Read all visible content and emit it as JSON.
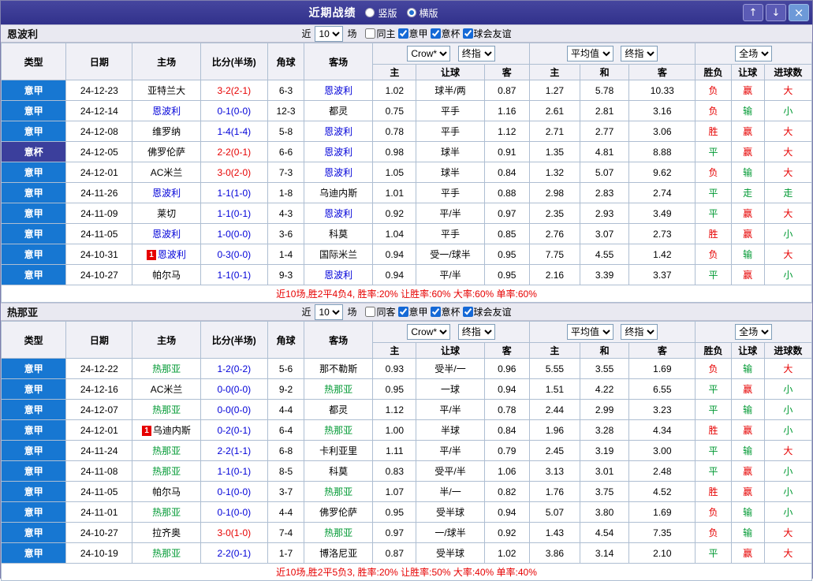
{
  "titlebar": {
    "title": "近期战绩",
    "radios": [
      "竖版",
      "横版"
    ],
    "selected_index": 1,
    "up_icon": "↑",
    "down_icon": "↓",
    "close_icon": "×"
  },
  "colors": {
    "r": "#e60000",
    "g": "#009933",
    "b": "#0000d8",
    "k": "#000000",
    "accent_blue": "#1569d6"
  },
  "league_colors": {
    "意甲": "#1777d2",
    "意杯": "#3b3f9c"
  },
  "filter": {
    "prefix": "近",
    "rounds": "10",
    "suffix": "场",
    "same_side_checked": false,
    "serie_a_label": "意甲",
    "serie_a_checked": true,
    "coppa_label": "意杯",
    "coppa_checked": true,
    "friendly_label": "球会友谊",
    "friendly_checked": true
  },
  "columns": {
    "type": "类型",
    "date": "日期",
    "home": "主场",
    "score": "比分(半场)",
    "corners": "角球",
    "away": "客场",
    "odds_home": "主",
    "odds_handicap": "让球",
    "odds_away": "客",
    "avg_home": "主",
    "avg_draw": "和",
    "avg_away": "客",
    "result": "胜负",
    "handicap_result": "让球",
    "goals": "进球数"
  },
  "selects": {
    "company": "Crow*",
    "company_stage": "终指",
    "average": "平均值",
    "average_stage": "终指",
    "scope": "全场"
  },
  "sections": [
    {
      "team": "恩波利",
      "same_side_label": "同主",
      "footer": "近10场,胜2平4负4, 胜率:20% 让胜率:60% 大率:60% 单率:60%",
      "rows": [
        {
          "league": "意甲",
          "date": "24-12-23",
          "home": "亚特兰大",
          "home_color": "k",
          "home_badge": "",
          "score": "3-2(2-1)",
          "score_color": "r",
          "corners": "6-3",
          "away": "恩波利",
          "away_color": "b",
          "away_badge": "",
          "odds": [
            "1.02",
            "球半/两",
            "0.87"
          ],
          "avg": [
            "1.27",
            "5.78",
            "10.33"
          ],
          "result": "负",
          "result_color": "r",
          "handicap_result": "赢",
          "handicap_color": "r",
          "goals": "大",
          "goals_color": "r"
        },
        {
          "league": "意甲",
          "date": "24-12-14",
          "home": "恩波利",
          "home_color": "b",
          "home_badge": "",
          "score": "0-1(0-0)",
          "score_color": "b",
          "corners": "12-3",
          "away": "都灵",
          "away_color": "k",
          "away_badge": "",
          "odds": [
            "0.75",
            "平手",
            "1.16"
          ],
          "avg": [
            "2.61",
            "2.81",
            "3.16"
          ],
          "result": "负",
          "result_color": "r",
          "handicap_result": "输",
          "handicap_color": "g",
          "goals": "小",
          "goals_color": "g"
        },
        {
          "league": "意甲",
          "date": "24-12-08",
          "home": "维罗纳",
          "home_color": "k",
          "home_badge": "",
          "score": "1-4(1-4)",
          "score_color": "b",
          "corners": "5-8",
          "away": "恩波利",
          "away_color": "b",
          "away_badge": "",
          "odds": [
            "0.78",
            "平手",
            "1.12"
          ],
          "avg": [
            "2.71",
            "2.77",
            "3.06"
          ],
          "result": "胜",
          "result_color": "r",
          "handicap_result": "赢",
          "handicap_color": "r",
          "goals": "大",
          "goals_color": "r"
        },
        {
          "league": "意杯",
          "date": "24-12-05",
          "home": "佛罗伦萨",
          "home_color": "k",
          "home_badge": "",
          "score": "2-2(0-1)",
          "score_color": "r",
          "corners": "6-6",
          "away": "恩波利",
          "away_color": "b",
          "away_badge": "",
          "odds": [
            "0.98",
            "球半",
            "0.91"
          ],
          "avg": [
            "1.35",
            "4.81",
            "8.88"
          ],
          "result": "平",
          "result_color": "g",
          "handicap_result": "赢",
          "handicap_color": "r",
          "goals": "大",
          "goals_color": "r"
        },
        {
          "league": "意甲",
          "date": "24-12-01",
          "home": "AC米兰",
          "home_color": "k",
          "home_badge": "",
          "score": "3-0(2-0)",
          "score_color": "r",
          "corners": "7-3",
          "away": "恩波利",
          "away_color": "b",
          "away_badge": "",
          "odds": [
            "1.05",
            "球半",
            "0.84"
          ],
          "avg": [
            "1.32",
            "5.07",
            "9.62"
          ],
          "result": "负",
          "result_color": "r",
          "handicap_result": "输",
          "handicap_color": "g",
          "goals": "大",
          "goals_color": "r"
        },
        {
          "league": "意甲",
          "date": "24-11-26",
          "home": "恩波利",
          "home_color": "b",
          "home_badge": "",
          "score": "1-1(1-0)",
          "score_color": "b",
          "corners": "1-8",
          "away": "乌迪内斯",
          "away_color": "k",
          "away_badge": "",
          "odds": [
            "1.01",
            "平手",
            "0.88"
          ],
          "avg": [
            "2.98",
            "2.83",
            "2.74"
          ],
          "result": "平",
          "result_color": "g",
          "handicap_result": "走",
          "handicap_color": "g",
          "goals": "走",
          "goals_color": "g"
        },
        {
          "league": "意甲",
          "date": "24-11-09",
          "home": "莱切",
          "home_color": "k",
          "home_badge": "",
          "score": "1-1(0-1)",
          "score_color": "b",
          "corners": "4-3",
          "away": "恩波利",
          "away_color": "b",
          "away_badge": "",
          "odds": [
            "0.92",
            "平/半",
            "0.97"
          ],
          "avg": [
            "2.35",
            "2.93",
            "3.49"
          ],
          "result": "平",
          "result_color": "g",
          "handicap_result": "赢",
          "handicap_color": "r",
          "goals": "大",
          "goals_color": "r"
        },
        {
          "league": "意甲",
          "date": "24-11-05",
          "home": "恩波利",
          "home_color": "b",
          "home_badge": "",
          "score": "1-0(0-0)",
          "score_color": "b",
          "corners": "3-6",
          "away": "科莫",
          "away_color": "k",
          "away_badge": "",
          "odds": [
            "1.04",
            "平手",
            "0.85"
          ],
          "avg": [
            "2.76",
            "3.07",
            "2.73"
          ],
          "result": "胜",
          "result_color": "r",
          "handicap_result": "赢",
          "handicap_color": "r",
          "goals": "小",
          "goals_color": "g"
        },
        {
          "league": "意甲",
          "date": "24-10-31",
          "home": "恩波利",
          "home_color": "b",
          "home_badge": "1",
          "score": "0-3(0-0)",
          "score_color": "b",
          "corners": "1-4",
          "away": "国际米兰",
          "away_color": "k",
          "away_badge": "",
          "odds": [
            "0.94",
            "受一/球半",
            "0.95"
          ],
          "avg": [
            "7.75",
            "4.55",
            "1.42"
          ],
          "result": "负",
          "result_color": "r",
          "handicap_result": "输",
          "handicap_color": "g",
          "goals": "大",
          "goals_color": "r"
        },
        {
          "league": "意甲",
          "date": "24-10-27",
          "home": "帕尔马",
          "home_color": "k",
          "home_badge": "",
          "score": "1-1(0-1)",
          "score_color": "b",
          "corners": "9-3",
          "away": "恩波利",
          "away_color": "b",
          "away_badge": "",
          "odds": [
            "0.94",
            "平/半",
            "0.95"
          ],
          "avg": [
            "2.16",
            "3.39",
            "3.37"
          ],
          "result": "平",
          "result_color": "g",
          "handicap_result": "赢",
          "handicap_color": "r",
          "goals": "小",
          "goals_color": "g"
        }
      ]
    },
    {
      "team": "热那亚",
      "same_side_label": "同客",
      "footer": "近10场,胜2平5负3, 胜率:20% 让胜率:50% 大率:40% 单率:40%",
      "rows": [
        {
          "league": "意甲",
          "date": "24-12-22",
          "home": "热那亚",
          "home_color": "g",
          "home_badge": "",
          "score": "1-2(0-2)",
          "score_color": "b",
          "corners": "5-6",
          "away": "那不勒斯",
          "away_color": "k",
          "away_badge": "",
          "odds": [
            "0.93",
            "受半/一",
            "0.96"
          ],
          "avg": [
            "5.55",
            "3.55",
            "1.69"
          ],
          "result": "负",
          "result_color": "r",
          "handicap_result": "输",
          "handicap_color": "g",
          "goals": "大",
          "goals_color": "r"
        },
        {
          "league": "意甲",
          "date": "24-12-16",
          "home": "AC米兰",
          "home_color": "k",
          "home_badge": "",
          "score": "0-0(0-0)",
          "score_color": "b",
          "corners": "9-2",
          "away": "热那亚",
          "away_color": "g",
          "away_badge": "",
          "odds": [
            "0.95",
            "一球",
            "0.94"
          ],
          "avg": [
            "1.51",
            "4.22",
            "6.55"
          ],
          "result": "平",
          "result_color": "g",
          "handicap_result": "赢",
          "handicap_color": "r",
          "goals": "小",
          "goals_color": "g"
        },
        {
          "league": "意甲",
          "date": "24-12-07",
          "home": "热那亚",
          "home_color": "g",
          "home_badge": "",
          "score": "0-0(0-0)",
          "score_color": "b",
          "corners": "4-4",
          "away": "都灵",
          "away_color": "k",
          "away_badge": "",
          "odds": [
            "1.12",
            "平/半",
            "0.78"
          ],
          "avg": [
            "2.44",
            "2.99",
            "3.23"
          ],
          "result": "平",
          "result_color": "g",
          "handicap_result": "输",
          "handicap_color": "g",
          "goals": "小",
          "goals_color": "g"
        },
        {
          "league": "意甲",
          "date": "24-12-01",
          "home": "乌迪内斯",
          "home_color": "k",
          "home_badge": "1",
          "score": "0-2(0-1)",
          "score_color": "b",
          "corners": "6-4",
          "away": "热那亚",
          "away_color": "g",
          "away_badge": "",
          "odds": [
            "1.00",
            "半球",
            "0.84"
          ],
          "avg": [
            "1.96",
            "3.28",
            "4.34"
          ],
          "result": "胜",
          "result_color": "r",
          "handicap_result": "赢",
          "handicap_color": "r",
          "goals": "小",
          "goals_color": "g"
        },
        {
          "league": "意甲",
          "date": "24-11-24",
          "home": "热那亚",
          "home_color": "g",
          "home_badge": "",
          "score": "2-2(1-1)",
          "score_color": "b",
          "corners": "6-8",
          "away": "卡利亚里",
          "away_color": "k",
          "away_badge": "",
          "odds": [
            "1.11",
            "平/半",
            "0.79"
          ],
          "avg": [
            "2.45",
            "3.19",
            "3.00"
          ],
          "result": "平",
          "result_color": "g",
          "handicap_result": "输",
          "handicap_color": "g",
          "goals": "大",
          "goals_color": "r"
        },
        {
          "league": "意甲",
          "date": "24-11-08",
          "home": "热那亚",
          "home_color": "g",
          "home_badge": "",
          "score": "1-1(0-1)",
          "score_color": "b",
          "corners": "8-5",
          "away": "科莫",
          "away_color": "k",
          "away_badge": "",
          "odds": [
            "0.83",
            "受平/半",
            "1.06"
          ],
          "avg": [
            "3.13",
            "3.01",
            "2.48"
          ],
          "result": "平",
          "result_color": "g",
          "handicap_result": "赢",
          "handicap_color": "r",
          "goals": "小",
          "goals_color": "g"
        },
        {
          "league": "意甲",
          "date": "24-11-05",
          "home": "帕尔马",
          "home_color": "k",
          "home_badge": "",
          "score": "0-1(0-0)",
          "score_color": "b",
          "corners": "3-7",
          "away": "热那亚",
          "away_color": "g",
          "away_badge": "",
          "odds": [
            "1.07",
            "半/一",
            "0.82"
          ],
          "avg": [
            "1.76",
            "3.75",
            "4.52"
          ],
          "result": "胜",
          "result_color": "r",
          "handicap_result": "赢",
          "handicap_color": "r",
          "goals": "小",
          "goals_color": "g"
        },
        {
          "league": "意甲",
          "date": "24-11-01",
          "home": "热那亚",
          "home_color": "g",
          "home_badge": "",
          "score": "0-1(0-0)",
          "score_color": "b",
          "corners": "4-4",
          "away": "佛罗伦萨",
          "away_color": "k",
          "away_badge": "",
          "odds": [
            "0.95",
            "受半球",
            "0.94"
          ],
          "avg": [
            "5.07",
            "3.80",
            "1.69"
          ],
          "result": "负",
          "result_color": "r",
          "handicap_result": "输",
          "handicap_color": "g",
          "goals": "小",
          "goals_color": "g"
        },
        {
          "league": "意甲",
          "date": "24-10-27",
          "home": "拉齐奥",
          "home_color": "k",
          "home_badge": "",
          "score": "3-0(1-0)",
          "score_color": "r",
          "corners": "7-4",
          "away": "热那亚",
          "away_color": "g",
          "away_badge": "",
          "odds": [
            "0.97",
            "一/球半",
            "0.92"
          ],
          "avg": [
            "1.43",
            "4.54",
            "7.35"
          ],
          "result": "负",
          "result_color": "r",
          "handicap_result": "输",
          "handicap_color": "g",
          "goals": "大",
          "goals_color": "r"
        },
        {
          "league": "意甲",
          "date": "24-10-19",
          "home": "热那亚",
          "home_color": "g",
          "home_badge": "",
          "score": "2-2(0-1)",
          "score_color": "b",
          "corners": "1-7",
          "away": "博洛尼亚",
          "away_color": "k",
          "away_badge": "",
          "odds": [
            "0.87",
            "受半球",
            "1.02"
          ],
          "avg": [
            "3.86",
            "3.14",
            "2.10"
          ],
          "result": "平",
          "result_color": "g",
          "handicap_result": "赢",
          "handicap_color": "r",
          "goals": "大",
          "goals_color": "r"
        }
      ]
    }
  ]
}
